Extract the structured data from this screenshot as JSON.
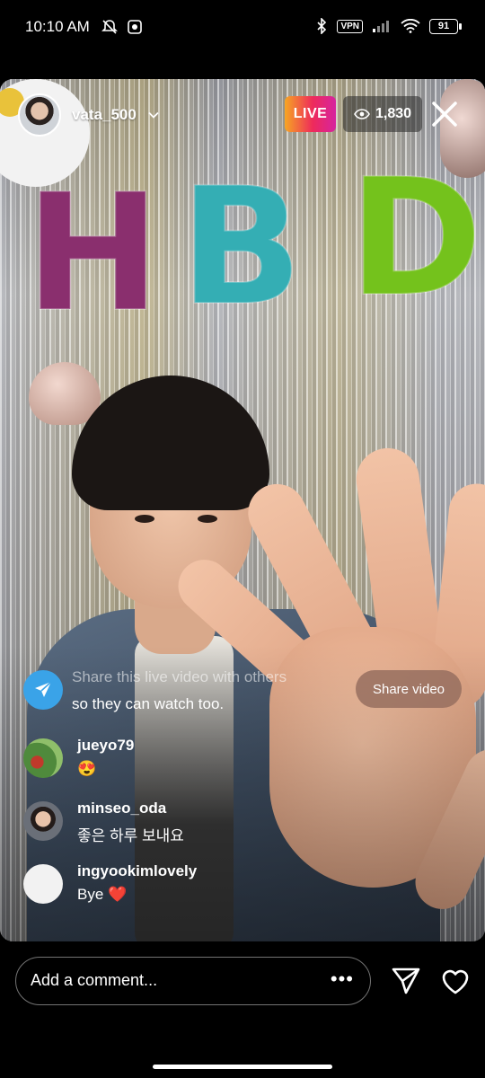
{
  "status_bar": {
    "time": "10:10 AM",
    "vpn": "VPN",
    "battery": "91",
    "icons": [
      "muted-bell-icon",
      "app-notification-icon",
      "bluetooth-icon",
      "vpn-icon",
      "signal-icon",
      "wifi-icon",
      "battery-icon"
    ]
  },
  "live": {
    "host_username": "vata_500",
    "live_label": "LIVE",
    "viewer_count": "1,830",
    "colors": {
      "live_gradient_start": "#f6a623",
      "live_gradient_end": "#d6249f"
    }
  },
  "share_prompt": {
    "line1": "Share this live video with others",
    "line2": "so they can watch too.",
    "button": "Share video",
    "icon_color": "#3aa3e8"
  },
  "comments": [
    {
      "username": "jueyo79",
      "text": "😍"
    },
    {
      "username": "minseo_oda",
      "text": "좋은 하루 보내요"
    },
    {
      "username": "ingyookimlovely",
      "text": "Bye",
      "emoji": "❤️"
    }
  ],
  "bottom_bar": {
    "comment_placeholder": "Add a comment...",
    "more": "•••"
  }
}
